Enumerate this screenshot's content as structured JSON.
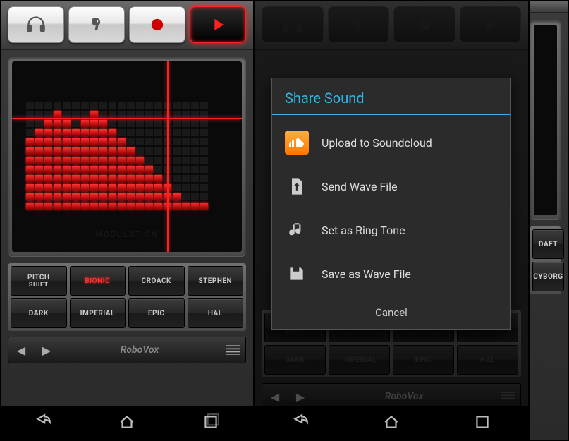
{
  "toolbar_active_index": 3,
  "visualizer": {
    "label": "MODULATION"
  },
  "presets": {
    "row1": [
      {
        "label": "PITCH",
        "label2": "SHIFT",
        "active": false
      },
      {
        "label": "BIONIC",
        "active": true
      },
      {
        "label": "CROACK",
        "active": false
      },
      {
        "label": "STEPHEN",
        "active": false
      }
    ],
    "row2": [
      {
        "label": "DARK",
        "active": false
      },
      {
        "label": "IMPERIAL",
        "active": false
      },
      {
        "label": "EPIC",
        "active": false
      },
      {
        "label": "HAL",
        "active": false
      }
    ]
  },
  "app_title": "RoboVox",
  "dialog": {
    "title": "Share Sound",
    "items": [
      {
        "icon": "soundcloud",
        "label": "Upload to Soundcloud"
      },
      {
        "icon": "file-up",
        "label": "Send Wave File"
      },
      {
        "icon": "music-note",
        "label": "Set as Ring Tone"
      },
      {
        "icon": "floppy",
        "label": "Save as Wave File"
      }
    ],
    "cancel": "Cancel"
  },
  "screen3_presets": [
    {
      "label": "DAFT"
    },
    {
      "label": "CYBORG"
    }
  ]
}
